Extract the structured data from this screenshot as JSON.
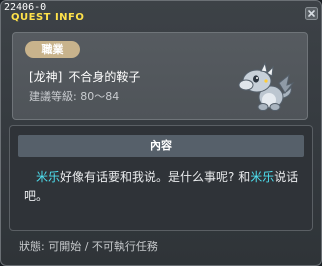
{
  "titlebar": {
    "quest_id": "22406-0",
    "title": "QUEST INFO"
  },
  "info": {
    "job_badge": "職業",
    "quest_bracket": "[龙神]",
    "quest_title": "不合身的鞍子",
    "level_label": "建議等級: 80～84"
  },
  "content": {
    "header": "內容",
    "npc_name_1": "米乐",
    "text_1": "好像有话要和我说。是什么事呢? 和",
    "npc_name_2": "米乐",
    "text_2": "说话吧。"
  },
  "status": {
    "text": "狀態: 可開始 / 不可執行任務"
  },
  "colors": {
    "title": "#ffe24a",
    "npc_highlight": "#4ee0f0",
    "badge": "#c8b38c",
    "header_bar": "#56606a"
  },
  "icons": {
    "close": "close-icon",
    "npc": "baby-dragon-npc-icon"
  }
}
